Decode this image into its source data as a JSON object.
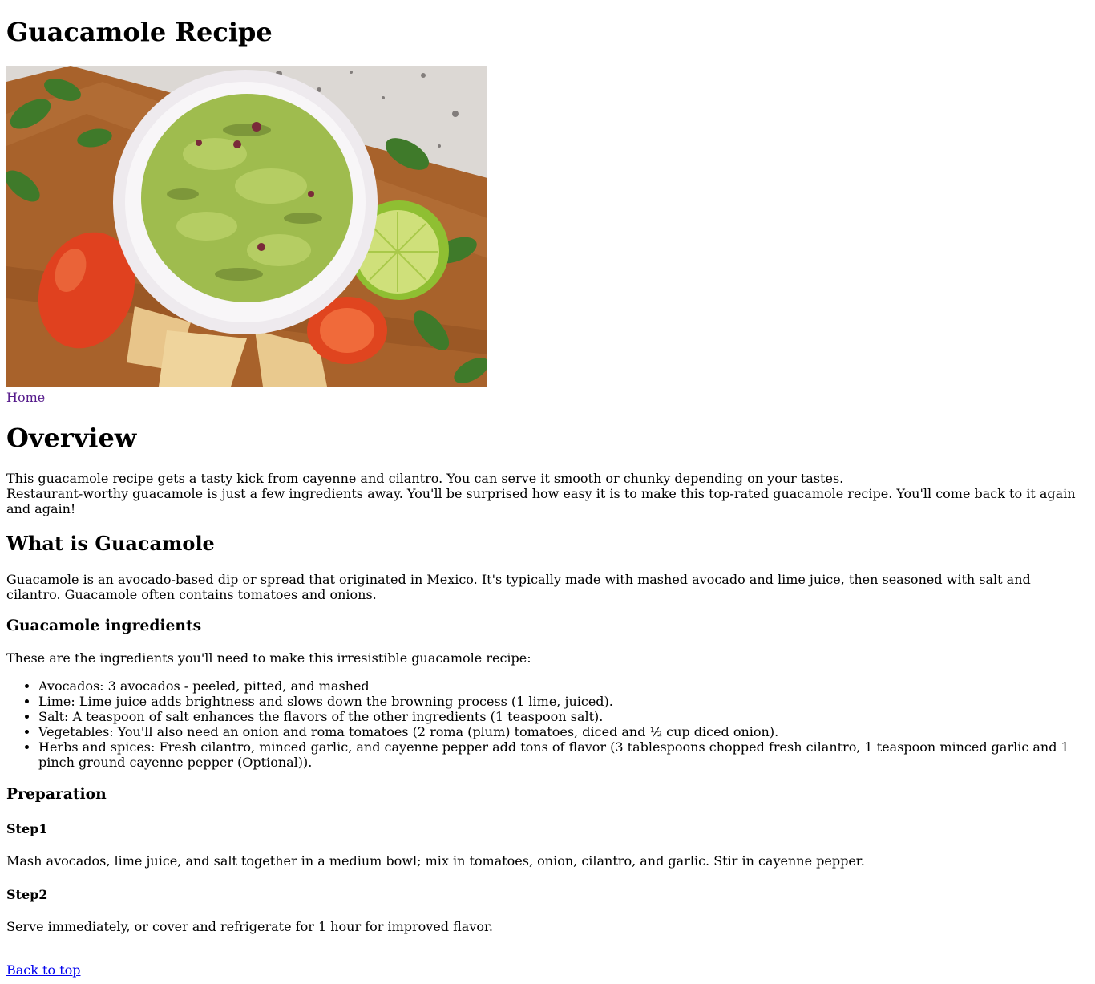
{
  "page": {
    "title": "Guacamole Recipe",
    "hero_image": {
      "alt": "Guacamole in a white bowl with tomatoes, lime, cilantro and tortilla chips"
    },
    "home_link": "Home"
  },
  "overview": {
    "heading": "Overview",
    "line1": "This guacamole recipe gets a tasty kick from cayenne and cilantro. You can serve it smooth or chunky depending on your tastes.",
    "line2": "Restaurant-worthy guacamole is just a few ingredients away. You'll be surprised how easy it is to make this top-rated guacamole recipe. You'll come back to it again and again!"
  },
  "what": {
    "heading": "What is Guacamole",
    "text": "Guacamole is an avocado-based dip or spread that originated in Mexico. It's typically made with mashed avocado and lime juice, then seasoned with salt and cilantro. Guacamole often contains tomatoes and onions."
  },
  "ingredients": {
    "heading": "Guacamole ingredients",
    "intro": "These are the ingredients you'll need to make this irresistible guacamole recipe:",
    "items": [
      "Avocados: 3 avocados - peeled, pitted, and mashed",
      "Lime: Lime juice adds brightness and slows down the browning process (1 lime, juiced).",
      "Salt: A teaspoon of salt enhances the flavors of the other ingredients (1 teaspoon salt).",
      "Vegetables: You'll also need an onion and roma tomatoes (2 roma (plum) tomatoes, diced and ½ cup diced onion).",
      "Herbs and spices: Fresh cilantro, minced garlic, and cayenne pepper add tons of flavor (3 tablespoons chopped fresh cilantro, 1 teaspoon minced garlic and 1 pinch ground cayenne pepper (Optional))."
    ]
  },
  "preparation": {
    "heading": "Preparation",
    "steps": [
      {
        "title": "Step1",
        "text": "Mash avocados, lime juice, and salt together in a medium bowl; mix in tomatoes, onion, cilantro, and garlic. Stir in cayenne pepper."
      },
      {
        "title": "Step2",
        "text": "Serve immediately, or cover and refrigerate for 1 hour for improved flavor."
      }
    ]
  },
  "footer": {
    "back_to_top": "Back to top"
  },
  "colors": {
    "link": "#0000ee",
    "visited_link": "#551a8b",
    "text": "#000000",
    "background": "#ffffff"
  }
}
